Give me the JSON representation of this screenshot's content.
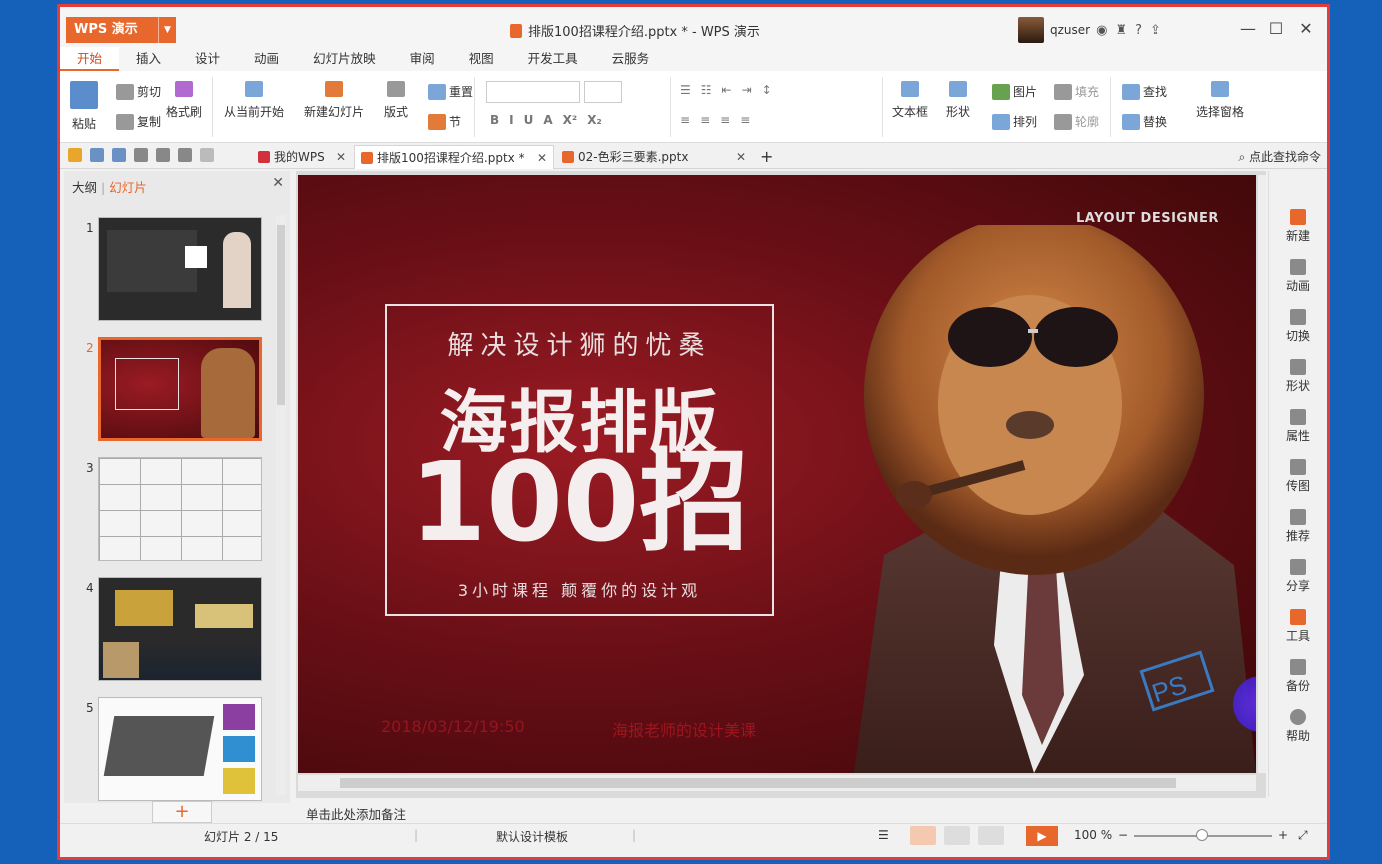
{
  "app": {
    "logo_label": "WPS 演示",
    "window_title": "排版100招课程介绍.pptx * - WPS 演示",
    "username": "qzuser"
  },
  "menubar": [
    "开始",
    "插入",
    "设计",
    "动画",
    "幻灯片放映",
    "审阅",
    "视图",
    "开发工具",
    "云服务"
  ],
  "ribbon": {
    "paste": "粘贴",
    "cut": "剪切",
    "copy": "复制",
    "format_painter": "格式刷",
    "from_current": "从当前开始",
    "new_slide": "新建幻灯片",
    "layout": "版式",
    "reset": "重置",
    "section": "节",
    "textbox": "文本框",
    "shape": "形状",
    "picture": "图片",
    "fill": "填充",
    "arrange": "排列",
    "outline": "轮廓",
    "find": "查找",
    "replace": "替换",
    "select_pane": "选择窗格"
  },
  "doc_tabs": [
    {
      "label": "我的WPS"
    },
    {
      "label": "排版100招课程介绍.pptx *"
    },
    {
      "label": "02-色彩三要素.pptx"
    }
  ],
  "find_command": "点此查找命令",
  "left_panel": {
    "tab_outline": "大纲",
    "tab_slides": "幻灯片",
    "slide_numbers": [
      "1",
      "2",
      "3",
      "4",
      "5"
    ]
  },
  "slide": {
    "designer": "LAYOUT DESIGNER",
    "subtitle_top": "解决设计狮的忧桑",
    "headline": "海报排版",
    "big_number": "100招",
    "subtitle_bottom": "3小时课程 颠覆你的设计观",
    "watermark_date": "2018/03/12/19:50",
    "watermark_text": "海报老师的设计美课"
  },
  "notes_placeholder": "单击此处添加备注",
  "right_bar": [
    "新建",
    "动画",
    "切换",
    "形状",
    "属性",
    "传图",
    "推荐",
    "分享",
    "工具",
    "备份",
    "帮助"
  ],
  "status": {
    "slide_count": "幻灯片 2 / 15",
    "template": "默认设计模板",
    "zoom": "100 %",
    "zoom_fraction": 0.5
  },
  "colors": {
    "accent": "#e8672c",
    "window_border": "#e23c3c"
  }
}
